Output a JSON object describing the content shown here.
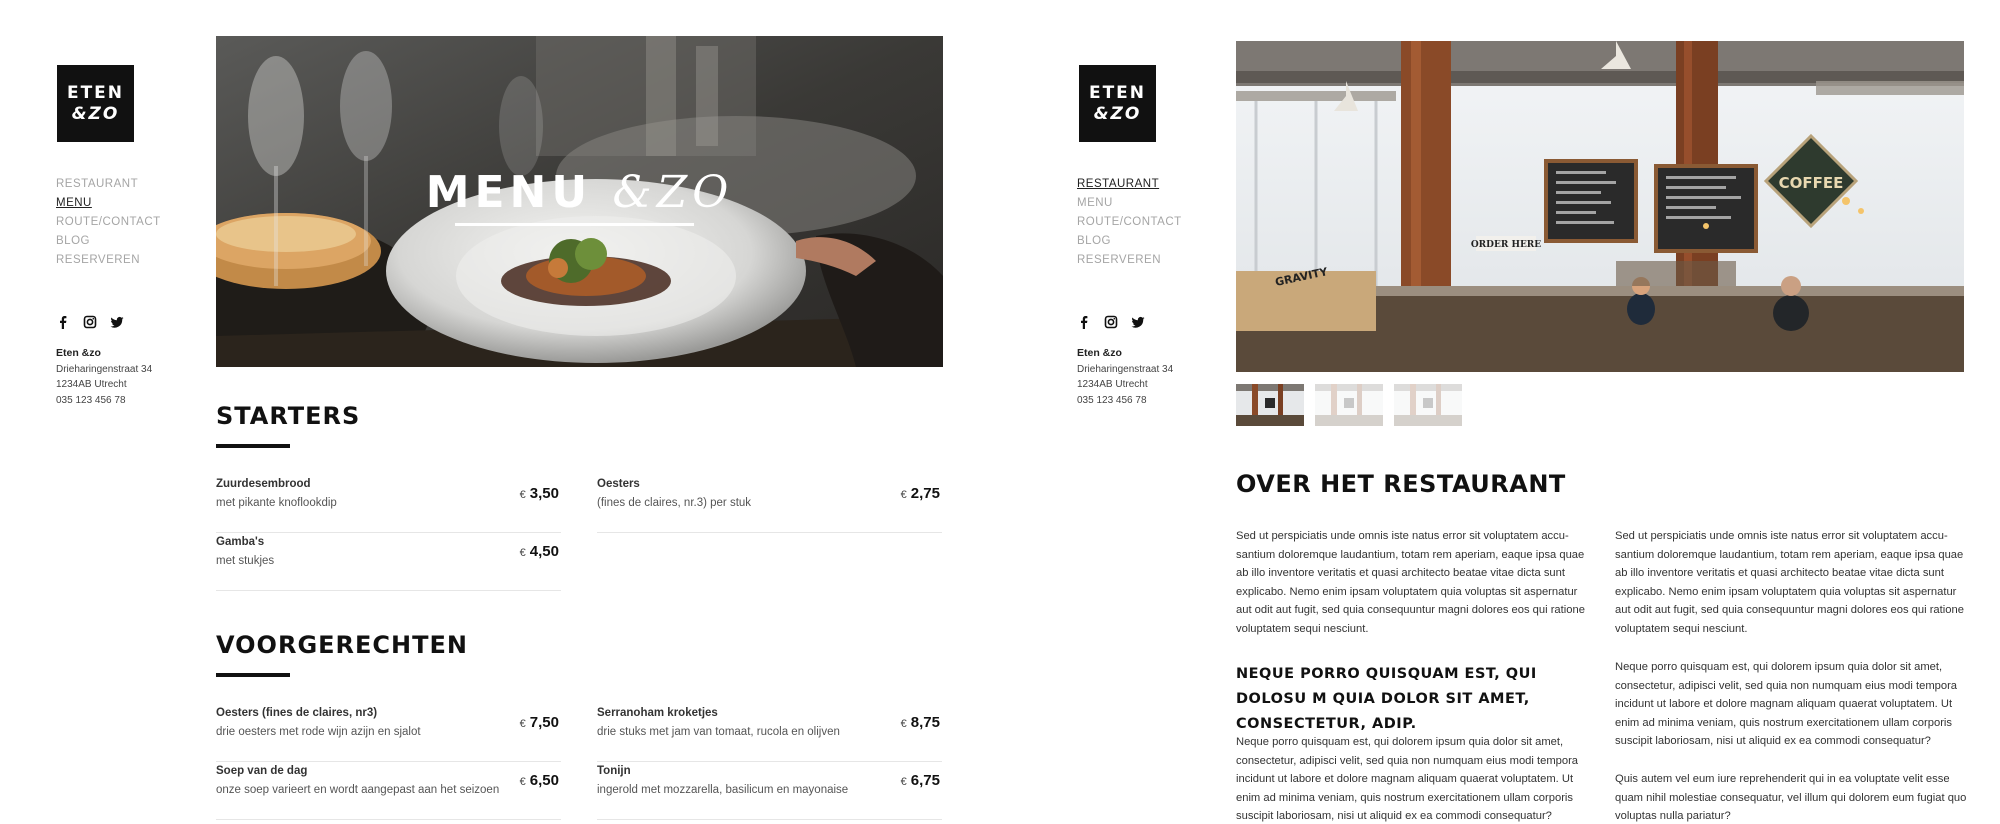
{
  "brand": {
    "logo_line1": "ETEN",
    "logo_line2": "&ZO"
  },
  "nav": [
    "RESTAURANT",
    "MENU",
    "ROUTE/CONTACT",
    "BLOG",
    "RESERVEREN"
  ],
  "address": {
    "name": "Eten &zo",
    "street": "Drieharingenstraat 34",
    "city": "1234AB Utrecht",
    "phone": "035 123 456 78"
  },
  "menu_page": {
    "active_nav": "MENU",
    "hero_title_a": "MENU",
    "hero_title_b": "&ZO",
    "currency": "€",
    "starters": {
      "title": "STARTERS",
      "items": [
        {
          "name": "Zuurdesembrood",
          "desc": "met pikante knoflookdip",
          "price": "3,50"
        },
        {
          "name": "Oesters",
          "desc": "(fines de claires, nr.3) per stuk",
          "price": "2,75"
        },
        {
          "name": "Gamba's",
          "desc": "met stukjes",
          "price": "4,50"
        }
      ]
    },
    "voorgerechten": {
      "title": "VOORGERECHTEN",
      "items": [
        {
          "name": "Oesters (fines de claires, nr3)",
          "desc": "drie oesters met rode wijn azijn en sjalot",
          "price": "7,50"
        },
        {
          "name": "Serranoham kroketjes",
          "desc": "drie stuks met jam van tomaat, rucola en olijven",
          "price": "8,75"
        },
        {
          "name": "Soep van de dag",
          "desc": "onze soep varieert en wordt aangepast aan het seizoen",
          "price": "6,50"
        },
        {
          "name": "Tonijn",
          "desc": "ingerold met mozzarella, basilicum en mayonaise",
          "price": "6,75"
        }
      ]
    }
  },
  "restaurant_page": {
    "active_nav": "RESTAURANT",
    "sign_coffee": "COFFEE",
    "sign_order": "ORDER HERE",
    "sign_gravity": "GRAVITY",
    "heading": "OVER HET RESTAURANT",
    "col1_para1": "Sed ut perspiciatis unde omnis iste natus error sit voluptatem accu-santium doloremque laudantium, totam rem aperiam, eaque ipsa quae ab illo inventore veritatis et quasi architecto beatae vitae dicta sunt explicabo. Nemo enim ipsam voluptatem quia voluptas sit aspernatur aut odit aut fugit, sed quia consequuntur magni dolores eos qui ratione voluptatem sequi nesciunt.",
    "subheading": "NEQUE PORRO QUISQUAM EST, QUI DOLOSU M QUIA DOLOR SIT AMET, CONSECTETUR, ADIP.",
    "col1_para2": "Neque porro quisquam est, qui dolorem ipsum quia dolor sit amet, consectetur, adipisci velit, sed quia non numquam eius modi tempora incidunt ut labore et dolore magnam aliquam quaerat voluptatem. Ut enim ad minima veniam, quis nostrum exercitationem ullam corporis suscipit laboriosam, nisi ut aliquid ex ea commodi consequatur?",
    "col2_para1": "Sed ut perspiciatis unde omnis iste natus error sit voluptatem accu-santium doloremque laudantium, totam rem aperiam, eaque ipsa quae ab illo inventore veritatis et quasi architecto beatae vitae dicta sunt explicabo. Nemo enim ipsam voluptatem quia voluptas sit aspernatur aut odit aut fugit, sed quia consequuntur magni dolores eos qui ratione voluptatem sequi nesciunt.",
    "col2_para2": "Neque porro quisquam est, qui dolorem ipsum quia dolor sit amet, consectetur, adipisci velit, sed quia non numquam eius modi tempora incidunt ut labore et dolore magnam aliquam quaerat voluptatem. Ut enim ad minima veniam, quis nostrum exercitationem ullam corporis suscipit laboriosam, nisi ut aliquid ex ea commodi consequatur?",
    "col2_para3": "Quis autem vel eum iure reprehenderit qui in ea voluptate velit esse quam nihil molestiae consequatur, vel illum qui dolorem eum fugiat quo voluptas nulla pariatur?"
  }
}
